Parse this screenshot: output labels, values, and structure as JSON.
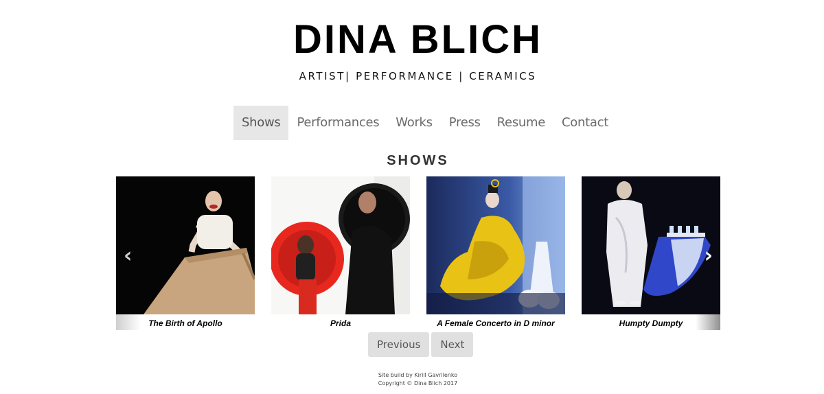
{
  "header": {
    "title": "DINA BLICH",
    "subtitle": "ARTIST| PERFORMANCE | CERAMICS"
  },
  "nav": {
    "items": [
      {
        "label": "Shows",
        "active": true
      },
      {
        "label": "Performances",
        "active": false
      },
      {
        "label": "Works",
        "active": false
      },
      {
        "label": "Press",
        "active": false
      },
      {
        "label": "Resume",
        "active": false
      },
      {
        "label": "Contact",
        "active": false
      }
    ]
  },
  "main": {
    "heading": "SHOWS",
    "carousel": {
      "prev_icon": "chevron-left-icon",
      "next_icon": "chevron-right-icon",
      "prev_arrow": "‹",
      "next_arrow": "›",
      "slides": [
        {
          "caption": "The Birth of Apollo"
        },
        {
          "caption": "Prida"
        },
        {
          "caption": "A Female Concerto in D minor"
        },
        {
          "caption": "Humpty Dumpty"
        }
      ]
    },
    "pager": {
      "previous_label": "Previous",
      "next_label": "Next"
    }
  },
  "footer": {
    "line1": "Site build by Kirill Gavrilenko",
    "line2": "Copyright © Dina Blich 2017"
  },
  "colors": {
    "nav_active_bg": "#e7e7e7",
    "nav_text": "#6b6b6b",
    "button_bg": "#e0e0e0"
  }
}
